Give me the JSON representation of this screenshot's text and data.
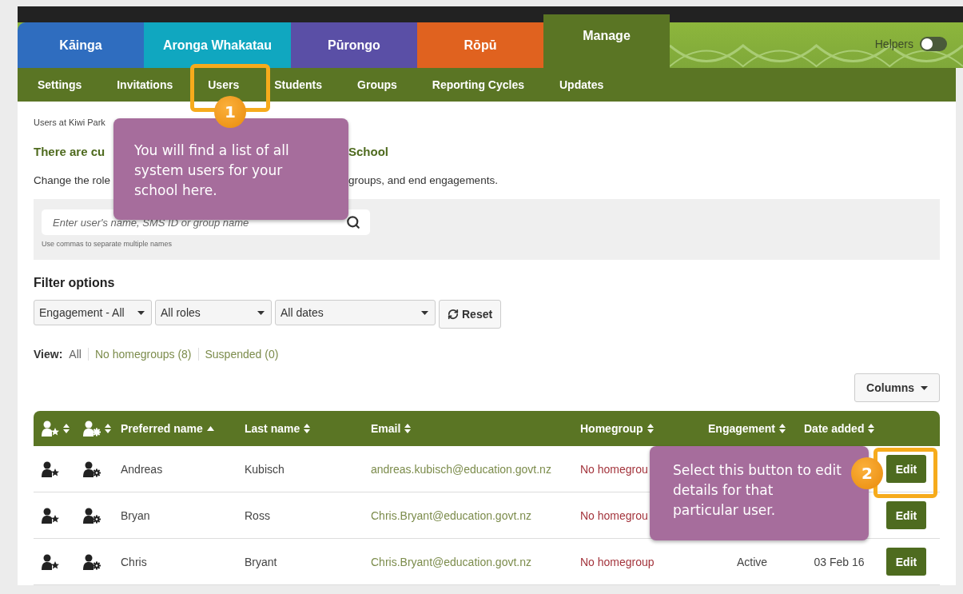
{
  "top_tabs": [
    {
      "label": "Kāinga",
      "color": "#2f6dbf",
      "selected": false
    },
    {
      "label": "Aronga Whakatau",
      "color": "#10a7c0",
      "selected": false
    },
    {
      "label": "Pūrongo",
      "color": "#5a4fa6",
      "selected": false
    },
    {
      "label": "Rōpū",
      "color": "#e0621f",
      "selected": false
    },
    {
      "label": "Manage",
      "color": "#5a7524",
      "selected": true
    }
  ],
  "helpers": {
    "label": "Helpers",
    "on": false
  },
  "subnav": [
    {
      "label": "Settings"
    },
    {
      "label": "Invitations"
    },
    {
      "label": "Users"
    },
    {
      "label": "Students"
    },
    {
      "label": "Groups"
    },
    {
      "label": "Reporting Cycles"
    },
    {
      "label": "Updates"
    }
  ],
  "breadcrumb": "Users at Kiwi Park",
  "heading": [
    "There are cu",
    "School"
  ],
  "description": [
    "Change the role",
    "groups, and end engagements."
  ],
  "search": {
    "placeholder": "Enter user's name, SMS ID or group name",
    "hint": "Use commas to separate multiple names"
  },
  "filter": {
    "title": "Filter options",
    "dropdowns": [
      "Engagement - All",
      "All roles",
      "All dates"
    ],
    "reset": "Reset"
  },
  "view": {
    "label": "View:",
    "options": [
      {
        "label": "All",
        "selected": true
      },
      {
        "label": "No homegroups (8)",
        "selected": false
      },
      {
        "label": "Suspended (0)",
        "selected": false
      }
    ]
  },
  "columns_button": "Columns",
  "table": {
    "columns": [
      {
        "kind": "star",
        "sorted": false
      },
      {
        "kind": "gear",
        "sorted": false
      },
      {
        "kind": "text",
        "label": "Preferred name",
        "sorted": true
      },
      {
        "kind": "text",
        "label": "Last name",
        "sorted": false
      },
      {
        "kind": "text",
        "label": "Email",
        "sorted": false
      },
      {
        "kind": "text",
        "label": "Homegroup",
        "sorted": false
      },
      {
        "kind": "text",
        "label": "Engagement",
        "sorted": false
      },
      {
        "kind": "text",
        "label": "Date added",
        "sorted": false
      }
    ],
    "rows": [
      {
        "preferred": "Andreas",
        "last": "Kubisch",
        "email": "andreas.kubisch@education.govt.nz",
        "homegroup": "No homegrou",
        "action": "Edit"
      },
      {
        "preferred": "Bryan",
        "last": "Ross",
        "email": "Chris.Bryant@education.govt.nz",
        "homegroup": "No homegrou",
        "action": "Edit"
      },
      {
        "preferred": "Chris",
        "last": "Bryant",
        "email": "Chris.Bryant@education.govt.nz",
        "homegroup": "No homegroup",
        "engagement": "Active",
        "date": "03 Feb 16",
        "action": "Edit"
      }
    ]
  },
  "callouts": [
    {
      "number": "1",
      "text": "You will find a list of all system users for your school here."
    },
    {
      "number": "2",
      "text": "Select this button to edit details for that particular user."
    }
  ]
}
